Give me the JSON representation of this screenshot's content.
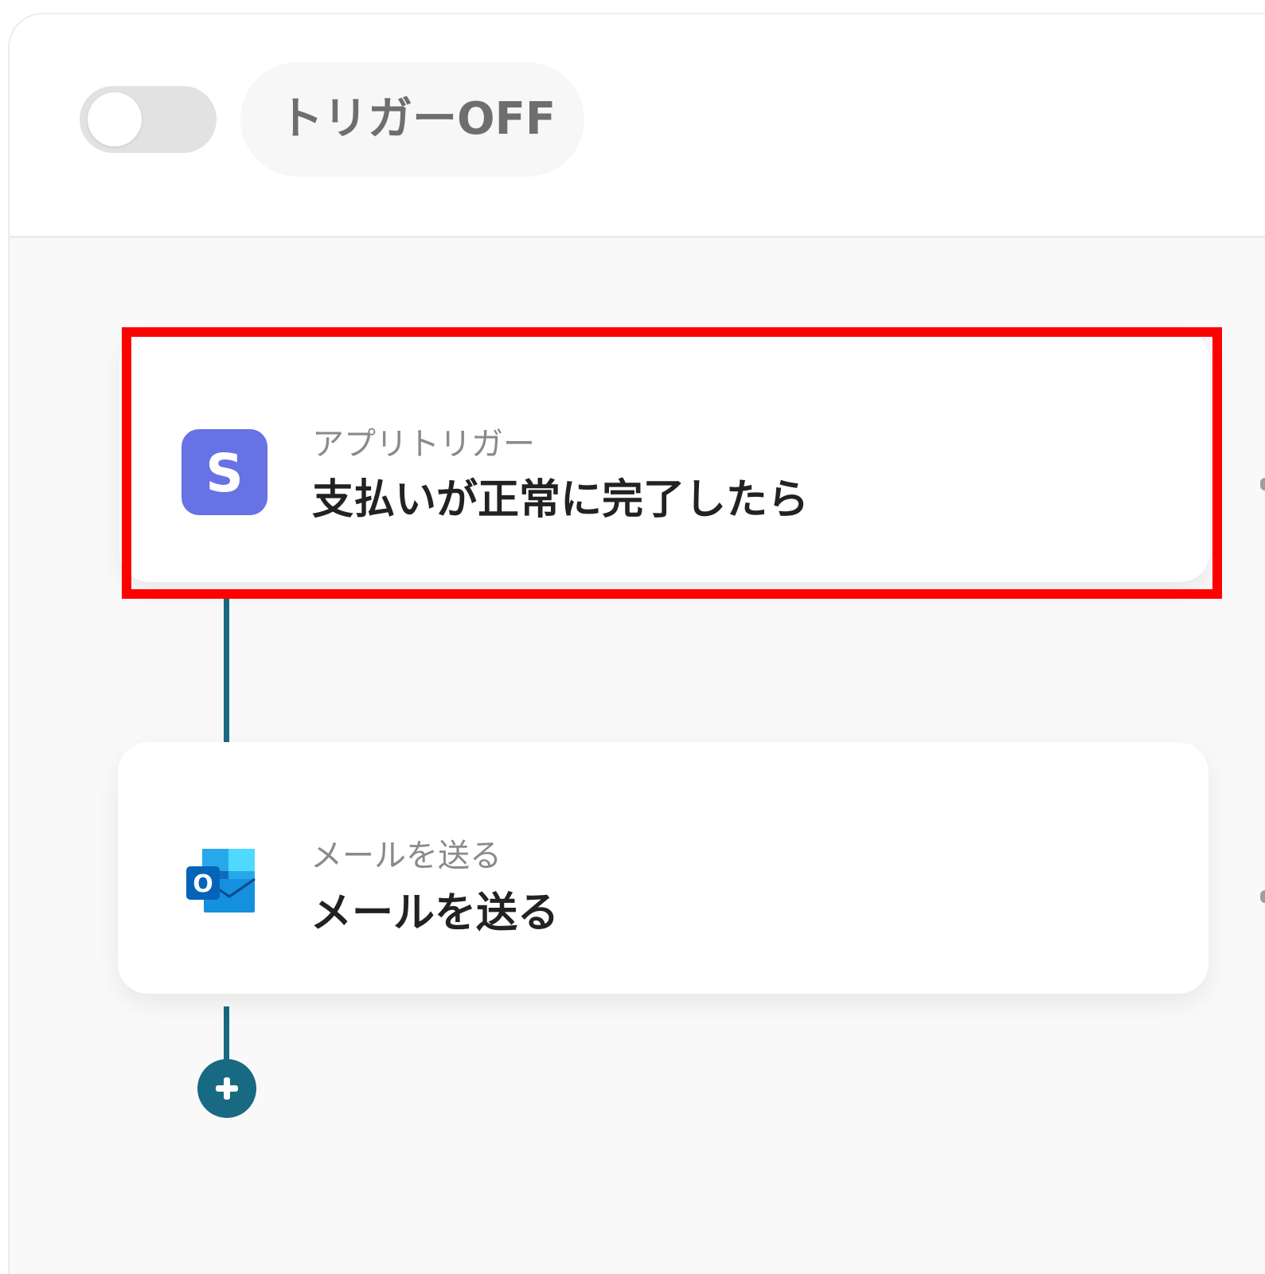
{
  "header": {
    "trigger_status_label": "トリガーOFF",
    "trigger_enabled": false
  },
  "flow": {
    "steps": [
      {
        "subtitle": "アプリトリガー",
        "title": "支払いが正常に完了したら",
        "icon": "stripe-icon",
        "icon_letter": "S",
        "highlighted": true
      },
      {
        "subtitle": "メールを送る",
        "title": "メールを送る",
        "icon": "outlook-icon",
        "icon_letter": "O",
        "highlighted": false
      }
    ],
    "add_step_icon": "plus-icon"
  },
  "colors": {
    "connector": "#176a82",
    "stripe_brand": "#6772e5",
    "highlight": "#ff0000",
    "toggle_off": "#e2e2e2"
  }
}
